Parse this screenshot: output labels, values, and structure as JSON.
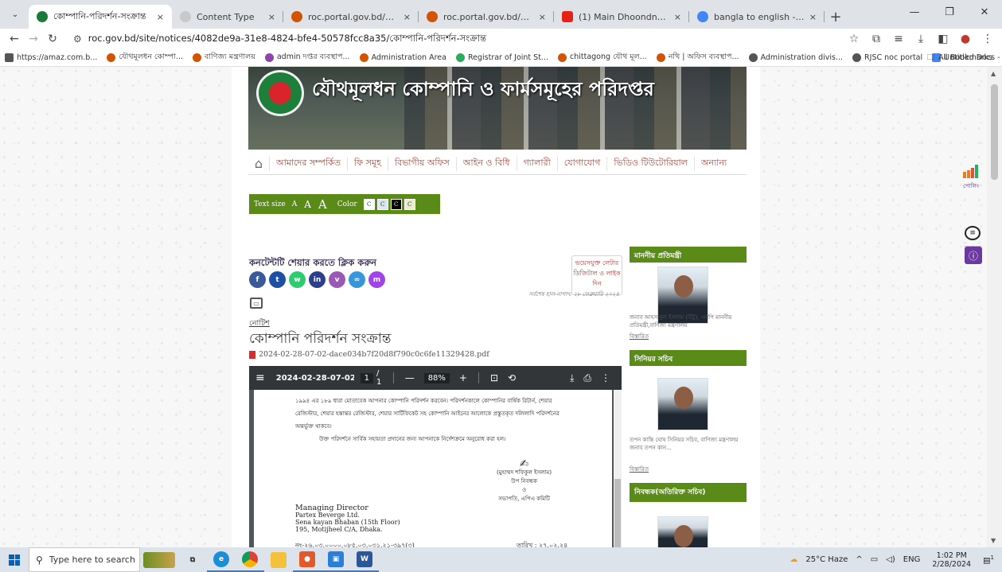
{
  "browser": {
    "tabs": [
      {
        "label": "কোম্পানি-পরিদর্শন-সংক্রান্ত",
        "favicon_color": "#1b7a3a",
        "active": true
      },
      {
        "label": "Content Type",
        "favicon_color": "#c9c9c9",
        "active": false
      },
      {
        "label": "roc.portal.gov.bd/npfadmin/pu",
        "favicon_color": "#d35400",
        "active": false
      },
      {
        "label": "roc.portal.gov.bd/npfadmin/pu",
        "favicon_color": "#d35400",
        "active": false
      },
      {
        "label": "(1) Main Dhoondne Ko Zam",
        "favicon_color": "#e62117",
        "active": false
      },
      {
        "label": "bangla to english - Google Sea",
        "favicon_color": "#4285f4",
        "active": false
      }
    ],
    "tab_close_glyph": "×",
    "url": "roc.gov.bd/site/notices/4082de9a-31e8-4824-bfe4-50578fcc8a35/কোম্পানি-পরিদর্শন-সংক্রান্ত",
    "bookmarks": [
      {
        "label": "https://amaz.com.b...",
        "color": "#555"
      },
      {
        "label": "যৌথমূলধন কোম্পা...",
        "color": "#d35400"
      },
      {
        "label": "বাণিজ্য মন্ত্রণালয়",
        "color": "#d35400"
      },
      {
        "label": "admin দপ্তর ব্যবস্থাপ...",
        "color": "#8e44ad"
      },
      {
        "label": "Administration Area",
        "color": "#d35400"
      },
      {
        "label": "Registrar of Joint St...",
        "color": "#27ae60"
      },
      {
        "label": "chittagong যৌথ মূল...",
        "color": "#d35400"
      },
      {
        "label": "নথি | অফিস ব্যবস্থাপ...",
        "color": "#d35400"
      },
      {
        "label": "Administration divis...",
        "color": "#555"
      },
      {
        "label": "RJSC noc portal",
        "color": "#555"
      },
      {
        "label": "Untitled Docs - Goo...",
        "color": "#4285f4"
      }
    ],
    "all_bookmarks": "All Bookmarks"
  },
  "site": {
    "banner_title": "যৌথমূলধন কোম্পানি ও ফার্মসমূহের পরিদপ্তর",
    "nav": [
      "আমাদের সম্পর্কিত",
      "ফি সমূহ",
      "বিভাগীয় অফিস",
      "আইন ও বিধি",
      "গ্যালারী",
      "যোগাযোগ",
      "ভিডিও টিউটোরিয়াল",
      "অন্যান্য"
    ],
    "a11y": {
      "text_size_label": "Text size",
      "sizes": [
        "A",
        "A",
        "A"
      ],
      "color_label": "Color",
      "swatch_letter": "C",
      "swatches": [
        "#ffffff",
        "#d9e7f5",
        "#000000",
        "#ececd0"
      ]
    },
    "share_title": "কনটেন্টটি শেয়ার করতে ক্লিক করুন",
    "share_buttons": [
      {
        "icon": "facebook-icon",
        "glyph": "f",
        "color": "#3b5998"
      },
      {
        "icon": "twitter-icon",
        "glyph": "t",
        "color": "#1d4fa5"
      },
      {
        "icon": "whatsapp-icon",
        "glyph": "w",
        "color": "#2ecc71"
      },
      {
        "icon": "linkedin-icon",
        "glyph": "in",
        "color": "#2c3e8c"
      },
      {
        "icon": "viber-icon",
        "glyph": "v",
        "color": "#9b59b6"
      },
      {
        "icon": "link-icon",
        "glyph": "🔗",
        "color": "#3498db"
      },
      {
        "icon": "messenger-icon",
        "glyph": "m",
        "color": "#a044e8"
      }
    ],
    "voice_box": "ভয়েসযুক্ত লেটার ডিজিটাল ও লাইক দিন",
    "updated": "সর্বশেষ হাল-নাগাদ: ২৮ ফেব্রুয়ারি ২০২৪",
    "notice_category": "নোটিশ",
    "notice_title": "কোম্পানি পরিদর্শন সংক্রান্ত",
    "pdf_filename": "2024-02-28-07-02-dace034b7f20d8f790c0c6fe11329428.pdf"
  },
  "pdf_viewer": {
    "filename": "2024-02-28-07-02-...",
    "page_current": "1",
    "page_total": "/ 1",
    "zoom": "88%",
    "lines": [
      "১৯৯৪ এর ১৮৯ ধারা মোতাবেক আপনার কোম্পানি পরিদর্শন করবেন। পরিদর্শনকালে কোম্পানির বার্ষিক রিটার্ন, শেয়ার",
      "রেজিস্টার, শেয়ার হস্তান্তর রেজিস্টার, শেয়ার সার্টিফিকেট সহ কোম্পানি আইনের আলোকে প্রস্তুতকৃত দলিলাদি পরিদর্শনের",
      "অন্তর্ভুক্ত থাকবে।",
      "উক্ত পরিদর্শনে সার্বিক সহায়তা প্রদানের জন্য আপনাকে নির্দেশক্রমে অনুরোধ করা হল।"
    ],
    "signature_name": "(মুহাম্মদ শফিকুল ইসলাম)",
    "signature_role": "উপ নিবন্ধক",
    "signature_and": "ও",
    "signature_role2": "সভাপতি, এপিএ কমিটি",
    "address": [
      "Managing Director",
      "Partex Beverge Ltd.",
      "Sena kayan Bhaban (15th Floor)",
      "195, Motijheel C/A, Dhaka."
    ],
    "ref_no": "নং-২৬.০৩.০০০০.০৮৫.০৩.০৩১.২১-৩৯৭(৩)",
    "date": "তারিখ : ২৭.০২.২৪"
  },
  "sidebar": {
    "minister_head": "মাননীয় প্রতিমন্ত্রী",
    "minister_text": "জনাব আহসানুল ইসলাম (টিটু), এমপি মাননীয় প্রতিমন্ত্রী,বাণিজ্য মন্ত্রণালয়",
    "minister_link": "বিস্তারিত",
    "secretary_head": "সিনিয়র সচিব",
    "secretary_text": "তপন কান্তি ঘোষ সিনিয়র সচিব, বাণিজ্য মন্ত্রণালয় জনাব তপন কান...",
    "secretary_link": "বিস্তারিত",
    "registrar_head": "নিবন্ধক(অতিরিক্ত সচিব)"
  },
  "float_widgets": [
    {
      "label": "পোলিং",
      "icon": "poll-chart-icon"
    },
    {
      "label": "মতামত",
      "icon": "chat-bubble-icon"
    },
    {
      "label": "",
      "icon": "accessibility-icon"
    }
  ],
  "taskbar": {
    "search_placeholder": "Type here to search",
    "weather": "25°C  Haze",
    "lang": "ENG",
    "time": "1:02 PM",
    "date": "2/28/2024",
    "notif_count": "1"
  }
}
